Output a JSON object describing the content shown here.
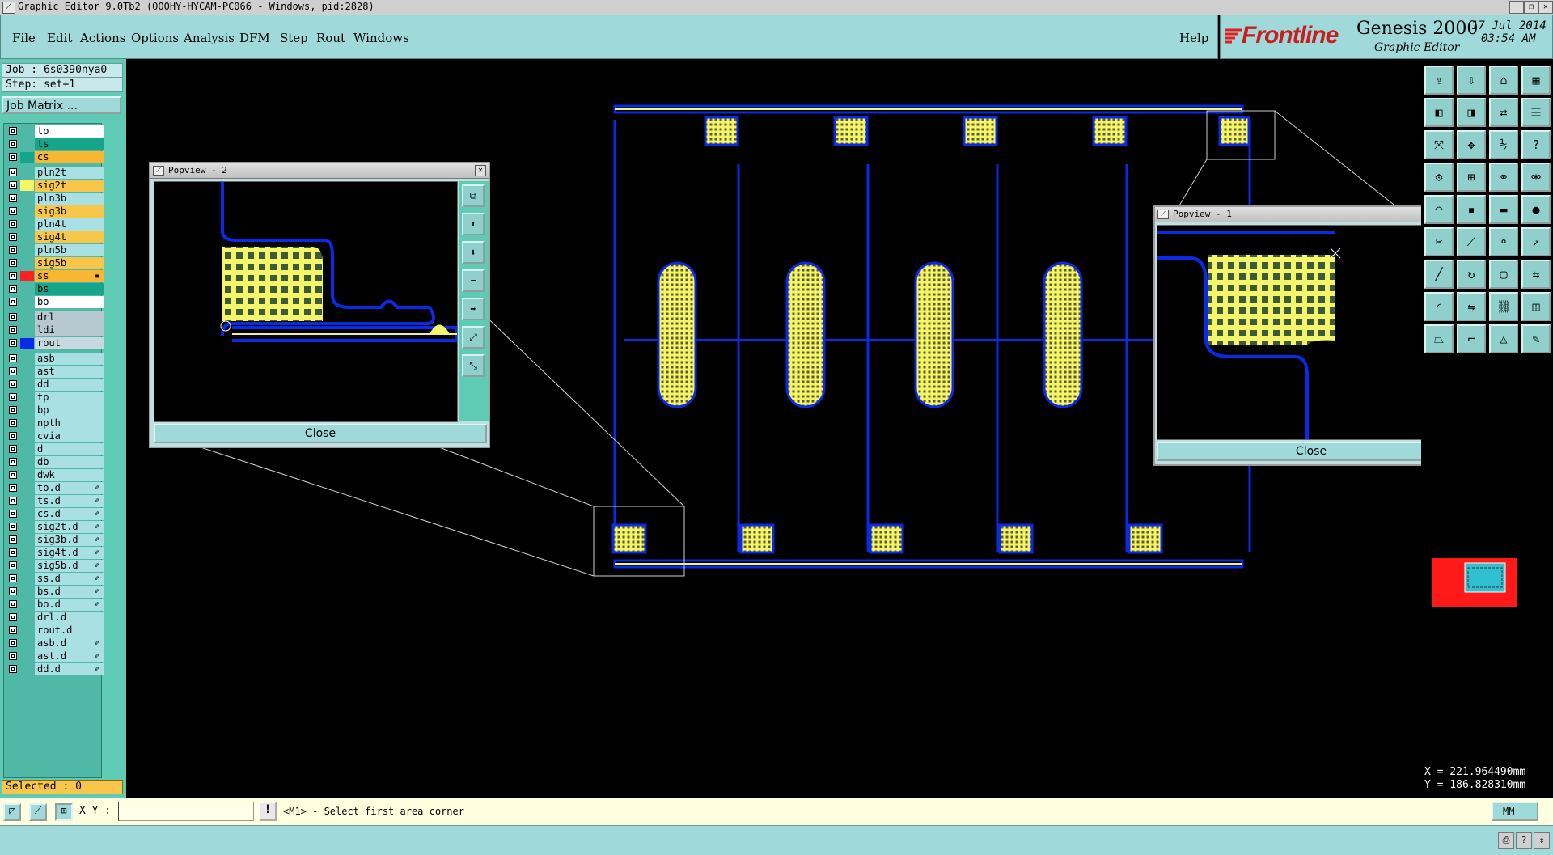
{
  "titlebar": {
    "title": "Graphic Editor 9.0Tb2 (OOOHY-HYCAM-PC066 - Windows, pid:2828)"
  },
  "menu": {
    "items": [
      "File",
      "Edit",
      "Actions",
      "Options",
      "Analysis",
      "DFM",
      "Step",
      "Rout",
      "Windows"
    ],
    "help": "Help"
  },
  "brand": {
    "logo": "Frontline",
    "product": "Genesis 2000",
    "subtitle": "Graphic Editor",
    "date": "17 Jul 2014",
    "time": "03:54 AM"
  },
  "job": {
    "job_line": "Job : 6s0390nya0",
    "step_line": "Step: set+1",
    "matrix_button": "Job Matrix ..."
  },
  "layers": [
    {
      "name": "to",
      "color": "#ffffff"
    },
    {
      "name": "ts",
      "color": "#16a58a"
    },
    {
      "name": "cs",
      "color": "#f7b733",
      "swatch": "#16a58a"
    },
    {
      "name": "pln2t",
      "color": "#a8e0e4"
    },
    {
      "name": "sig2t",
      "color": "#f7c64a",
      "swatch": "#f5f56a"
    },
    {
      "name": "pln3b",
      "color": "#a8e0e4"
    },
    {
      "name": "sig3b",
      "color": "#f7c64a"
    },
    {
      "name": "pln4t",
      "color": "#a8e0e4"
    },
    {
      "name": "sig4t",
      "color": "#f7c64a"
    },
    {
      "name": "pln5b",
      "color": "#a8e0e4"
    },
    {
      "name": "sig5b",
      "color": "#f7c64a"
    },
    {
      "name": "ss",
      "color": "#f7b733",
      "swatch": "#ff2020",
      "edit": "▪"
    },
    {
      "name": "bs",
      "color": "#16a58a"
    },
    {
      "name": "bo",
      "color": "#ffffff"
    },
    {
      "name": "drl",
      "color": "#b8c8d0"
    },
    {
      "name": "ldi",
      "color": "#b8c8d0"
    },
    {
      "name": "rout",
      "color": "#c8d8e0",
      "swatch": "#0a2ae8"
    },
    {
      "name": "asb",
      "color": "#a8e0e4"
    },
    {
      "name": "ast",
      "color": "#a8e0e4"
    },
    {
      "name": "dd",
      "color": "#a8e0e4"
    },
    {
      "name": "tp",
      "color": "#a8e0e4"
    },
    {
      "name": "bp",
      "color": "#a8e0e4"
    },
    {
      "name": "npth",
      "color": "#a8e0e4"
    },
    {
      "name": "cvia",
      "color": "#a8e0e4"
    },
    {
      "name": "d",
      "color": "#a8e0e4"
    },
    {
      "name": "db",
      "color": "#a8e0e4"
    },
    {
      "name": "dwk",
      "color": "#a8e0e4"
    },
    {
      "name": "to.d",
      "color": "#a8e0e4",
      "edit": "✐"
    },
    {
      "name": "ts.d",
      "color": "#a8e0e4",
      "edit": "✐"
    },
    {
      "name": "cs.d",
      "color": "#a8e0e4",
      "edit": "✐"
    },
    {
      "name": "sig2t.d",
      "color": "#a8e0e4",
      "edit": "✐"
    },
    {
      "name": "sig3b.d",
      "color": "#a8e0e4",
      "edit": "✐"
    },
    {
      "name": "sig4t.d",
      "color": "#a8e0e4",
      "edit": "✐"
    },
    {
      "name": "sig5b.d",
      "color": "#a8e0e4",
      "edit": "✐"
    },
    {
      "name": "ss.d",
      "color": "#a8e0e4",
      "edit": "✐"
    },
    {
      "name": "bs.d",
      "color": "#a8e0e4",
      "edit": "✐"
    },
    {
      "name": "bo.d",
      "color": "#a8e0e4",
      "edit": "✐"
    },
    {
      "name": "drl.d",
      "color": "#a8e0e4"
    },
    {
      "name": "rout.d",
      "color": "#a8e0e4"
    },
    {
      "name": "asb.d",
      "color": "#a8e0e4",
      "edit": "✐"
    },
    {
      "name": "ast.d",
      "color": "#a8e0e4",
      "edit": "✐"
    },
    {
      "name": "dd.d",
      "color": "#a8e0e4",
      "edit": "✐"
    }
  ],
  "selected": "Selected : 0",
  "popview2": {
    "title": "Popview - 2",
    "close": "Close"
  },
  "popview1": {
    "title": "Popview - 1",
    "close": "Close"
  },
  "coords": {
    "x": "X = 221.964490mm",
    "y": "Y = 186.828310mm"
  },
  "status": {
    "xy_label": "X Y :",
    "xy_value": "",
    "prompt": "<M1> - Select first area corner",
    "units": "MM"
  },
  "colors": {
    "panel": "#9fd9d9",
    "rout": "#0a2ae8",
    "copper": "#f5f56a",
    "canvas": "#000000"
  }
}
